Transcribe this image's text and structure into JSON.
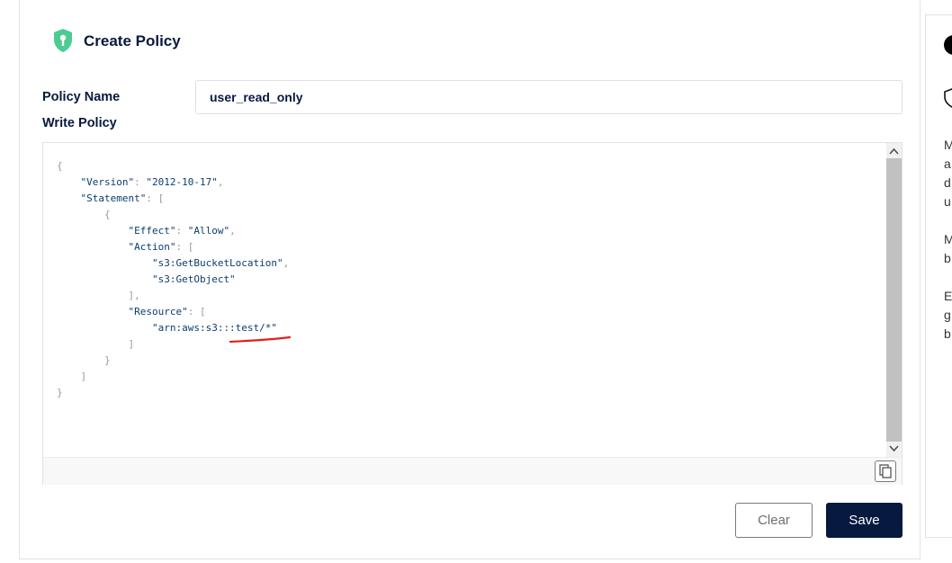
{
  "header": {
    "title": "Create Policy",
    "icon": "shield-key-icon",
    "accent": "#4CCB92"
  },
  "form": {
    "policy_name_label": "Policy Name",
    "policy_name_value": "user_read_only",
    "write_policy_label": "Write Policy"
  },
  "editor": {
    "lines": [
      "{",
      "    \"Version\": \"2012-10-17\",",
      "    \"Statement\": [",
      "        {",
      "            \"Effect\": \"Allow\",",
      "            \"Action\": [",
      "                \"s3:GetBucketLocation\",",
      "                \"s3:GetObject\"",
      "            ],",
      "            \"Resource\": [",
      "                \"arn:aws:s3:::test/*\"",
      "            ]",
      "        }",
      "    ]",
      "}"
    ],
    "copy_icon": "copy-icon"
  },
  "actions": {
    "clear_label": "Clear",
    "save_label": "Save"
  },
  "side_panel": {
    "lines": [
      "M",
      "a",
      "d",
      "u",
      "M",
      "b",
      "E",
      "g",
      "b"
    ]
  },
  "colors": {
    "primary": "#07193E",
    "annotation": "#E0201B"
  }
}
